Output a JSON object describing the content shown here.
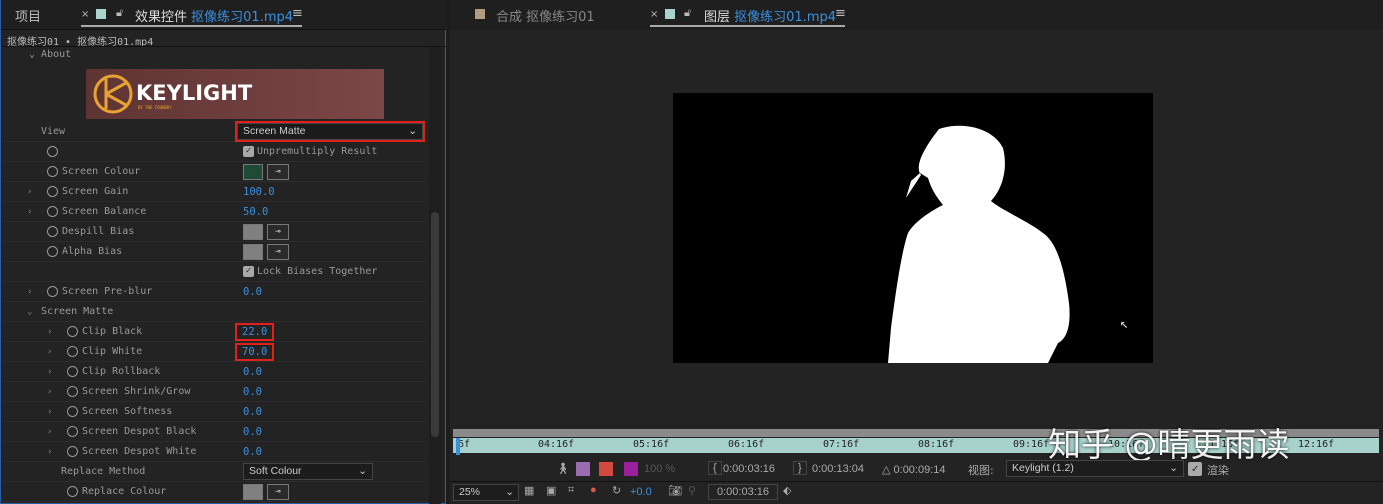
{
  "left_panel": {
    "tabs": {
      "project": "项目",
      "effects_title": "效果控件",
      "effects_file": "抠像练习01.mp4"
    },
    "breadcrumb": "抠像练习01 • 抠像练习01.mp4",
    "about": "About",
    "logo_text": "KEYLIGHT",
    "logo_sub": "BY THE FOUNDRY",
    "rows": {
      "view": {
        "label": "View",
        "value": "Screen Matte"
      },
      "unpremultiply": {
        "label": "Unpremultiply Result",
        "checked": true
      },
      "screen_colour": {
        "label": "Screen Colour",
        "color": "#1f4a35"
      },
      "screen_gain": {
        "label": "Screen Gain",
        "value": "100.0"
      },
      "screen_balance": {
        "label": "Screen Balance",
        "value": "50.0"
      },
      "despill_bias": {
        "label": "Despill Bias",
        "color": "#808080"
      },
      "alpha_bias": {
        "label": "Alpha Bias",
        "color": "#808080"
      },
      "lock_biases": {
        "label": "Lock Biases Together",
        "checked": true
      },
      "screen_preblur": {
        "label": "Screen Pre-blur",
        "value": "0.0"
      },
      "screen_matte": {
        "label": "Screen Matte"
      },
      "clip_black": {
        "label": "Clip Black",
        "value": "22.0"
      },
      "clip_white": {
        "label": "Clip White",
        "value": "70.0"
      },
      "clip_rollback": {
        "label": "Clip Rollback",
        "value": "0.0"
      },
      "shrink_grow": {
        "label": "Screen Shrink/Grow",
        "value": "0.0"
      },
      "softness": {
        "label": "Screen Softness",
        "value": "0.0"
      },
      "despot_black": {
        "label": "Screen Despot Black",
        "value": "0.0"
      },
      "despot_white": {
        "label": "Screen Despot White",
        "value": "0.0"
      },
      "replace_method": {
        "label": "Replace Method",
        "value": "Soft Colour"
      },
      "replace_colour": {
        "label": "Replace Colour",
        "color": "#808080"
      }
    }
  },
  "right_panel": {
    "tabs": {
      "comp": "合成 抠像练习01",
      "layer_prefix": "图层",
      "layer_file": "抠像练习01.mp4"
    },
    "timeline_ticks": [
      "6f",
      "04:16f",
      "05:16f",
      "06:16f",
      "07:16f",
      "08:16f",
      "09:16f",
      "10:16f",
      "11:16f",
      "12:16f"
    ],
    "opacity": "100 %",
    "in_time": "0:00:03:16",
    "out_time": "0:00:13:04",
    "duration": "△ 0:00:09:14",
    "view_label": "视图:",
    "view_value": "Keylight (1.2)",
    "render_label": "渲染",
    "zoom": "25%",
    "exposure": "+0.0",
    "current_time": "0:00:03:16",
    "watermark": "知乎 @晴更雨读"
  }
}
